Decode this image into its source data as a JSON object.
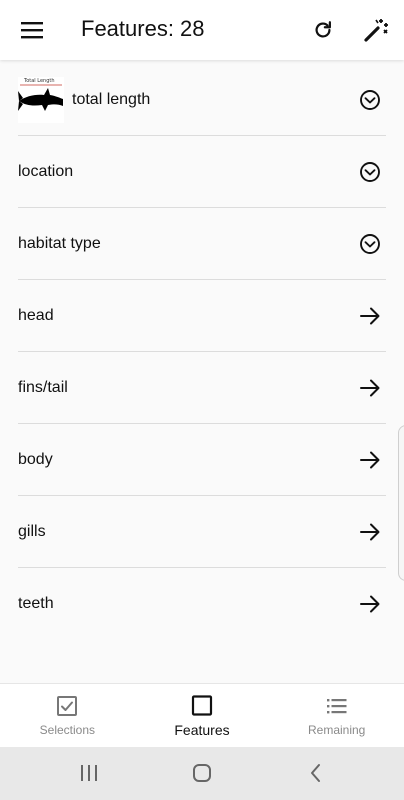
{
  "header": {
    "title": "Features: 28",
    "menu_icon": "hamburger-menu-icon",
    "refresh_icon": "refresh-icon",
    "wand_icon": "magic-wand-icon"
  },
  "features": [
    {
      "label": "total length",
      "thumbnail_caption": "Total Length",
      "action_icon": "chevron-down-circle-icon"
    },
    {
      "label": "location",
      "action_icon": "chevron-down-circle-icon"
    },
    {
      "label": "habitat type",
      "action_icon": "chevron-down-circle-icon"
    },
    {
      "label": "head",
      "action_icon": "arrow-right-icon"
    },
    {
      "label": "fins/tail",
      "action_icon": "arrow-right-icon"
    },
    {
      "label": "body",
      "action_icon": "arrow-right-icon"
    },
    {
      "label": "gills",
      "action_icon": "arrow-right-icon"
    },
    {
      "label": "teeth",
      "action_icon": "arrow-right-icon"
    }
  ],
  "bottom_nav": {
    "items": [
      {
        "label": "Selections",
        "icon": "checkbox-checked-icon",
        "active": false
      },
      {
        "label": "Features",
        "icon": "square-outline-icon",
        "active": true
      },
      {
        "label": "Remaining",
        "icon": "list-icon",
        "active": false
      }
    ]
  },
  "system_nav": {
    "recents_icon": "recents-icon",
    "home_icon": "home-icon",
    "back_icon": "back-icon"
  },
  "colors": {
    "background": "#fafafa",
    "app_bar": "#ffffff",
    "divider": "#dcdcdc",
    "inactive_text": "#8a8a8a",
    "system_bar": "#e8e8e8"
  }
}
